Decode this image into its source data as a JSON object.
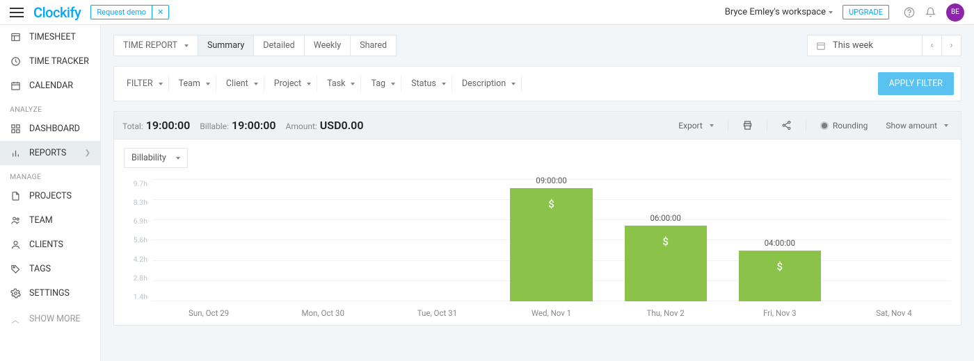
{
  "topbar": {
    "logo": "Clockify",
    "request_demo": "Request demo",
    "workspace": "Bryce Emley's workspace",
    "upgrade": "UPGRADE",
    "avatar_initials": "BE"
  },
  "sidebar": {
    "items": [
      {
        "label": "TIMESHEET"
      },
      {
        "label": "TIME TRACKER"
      },
      {
        "label": "CALENDAR"
      }
    ],
    "analyze_label": "ANALYZE",
    "analyze_items": [
      {
        "label": "DASHBOARD"
      },
      {
        "label": "REPORTS"
      }
    ],
    "manage_label": "MANAGE",
    "manage_items": [
      {
        "label": "PROJECTS"
      },
      {
        "label": "TEAM"
      },
      {
        "label": "CLIENTS"
      },
      {
        "label": "TAGS"
      },
      {
        "label": "SETTINGS"
      }
    ],
    "show_more": "SHOW MORE"
  },
  "report_tabs": {
    "lead": "TIME REPORT",
    "summary": "Summary",
    "detailed": "Detailed",
    "weekly": "Weekly",
    "shared": "Shared"
  },
  "date_range": {
    "label": "This week"
  },
  "filters": {
    "filter": "FILTER",
    "team": "Team",
    "client": "Client",
    "project": "Project",
    "task": "Task",
    "tag": "Tag",
    "status": "Status",
    "description": "Description",
    "apply": "APPLY FILTER"
  },
  "summary": {
    "total_label": "Total:",
    "total_value": "19:00:00",
    "billable_label": "Billable:",
    "billable_value": "19:00:00",
    "amount_label": "Amount:",
    "amount_value": "USD0.00",
    "export": "Export",
    "rounding": "Rounding",
    "show_amount": "Show amount",
    "billability": "Billability"
  },
  "chart_data": {
    "type": "bar",
    "categories": [
      "Sun, Oct 29",
      "Mon, Oct 30",
      "Tue, Oct 31",
      "Wed, Nov 1",
      "Thu, Nov 2",
      "Fri, Nov 3",
      "Sat, Nov 4"
    ],
    "values_hours": [
      0,
      0,
      0,
      9,
      6,
      4,
      0
    ],
    "value_labels": [
      "",
      "",
      "",
      "09:00:00",
      "06:00:00",
      "04:00:00",
      ""
    ],
    "y_ticks": [
      "9.7h",
      "8.3h",
      "6.9h",
      "5.6h",
      "4.2h",
      "2.8h",
      "1.4h"
    ],
    "ylim": [
      0,
      9.7
    ],
    "bar_color": "#8bc34a",
    "bar_badge": "$"
  }
}
